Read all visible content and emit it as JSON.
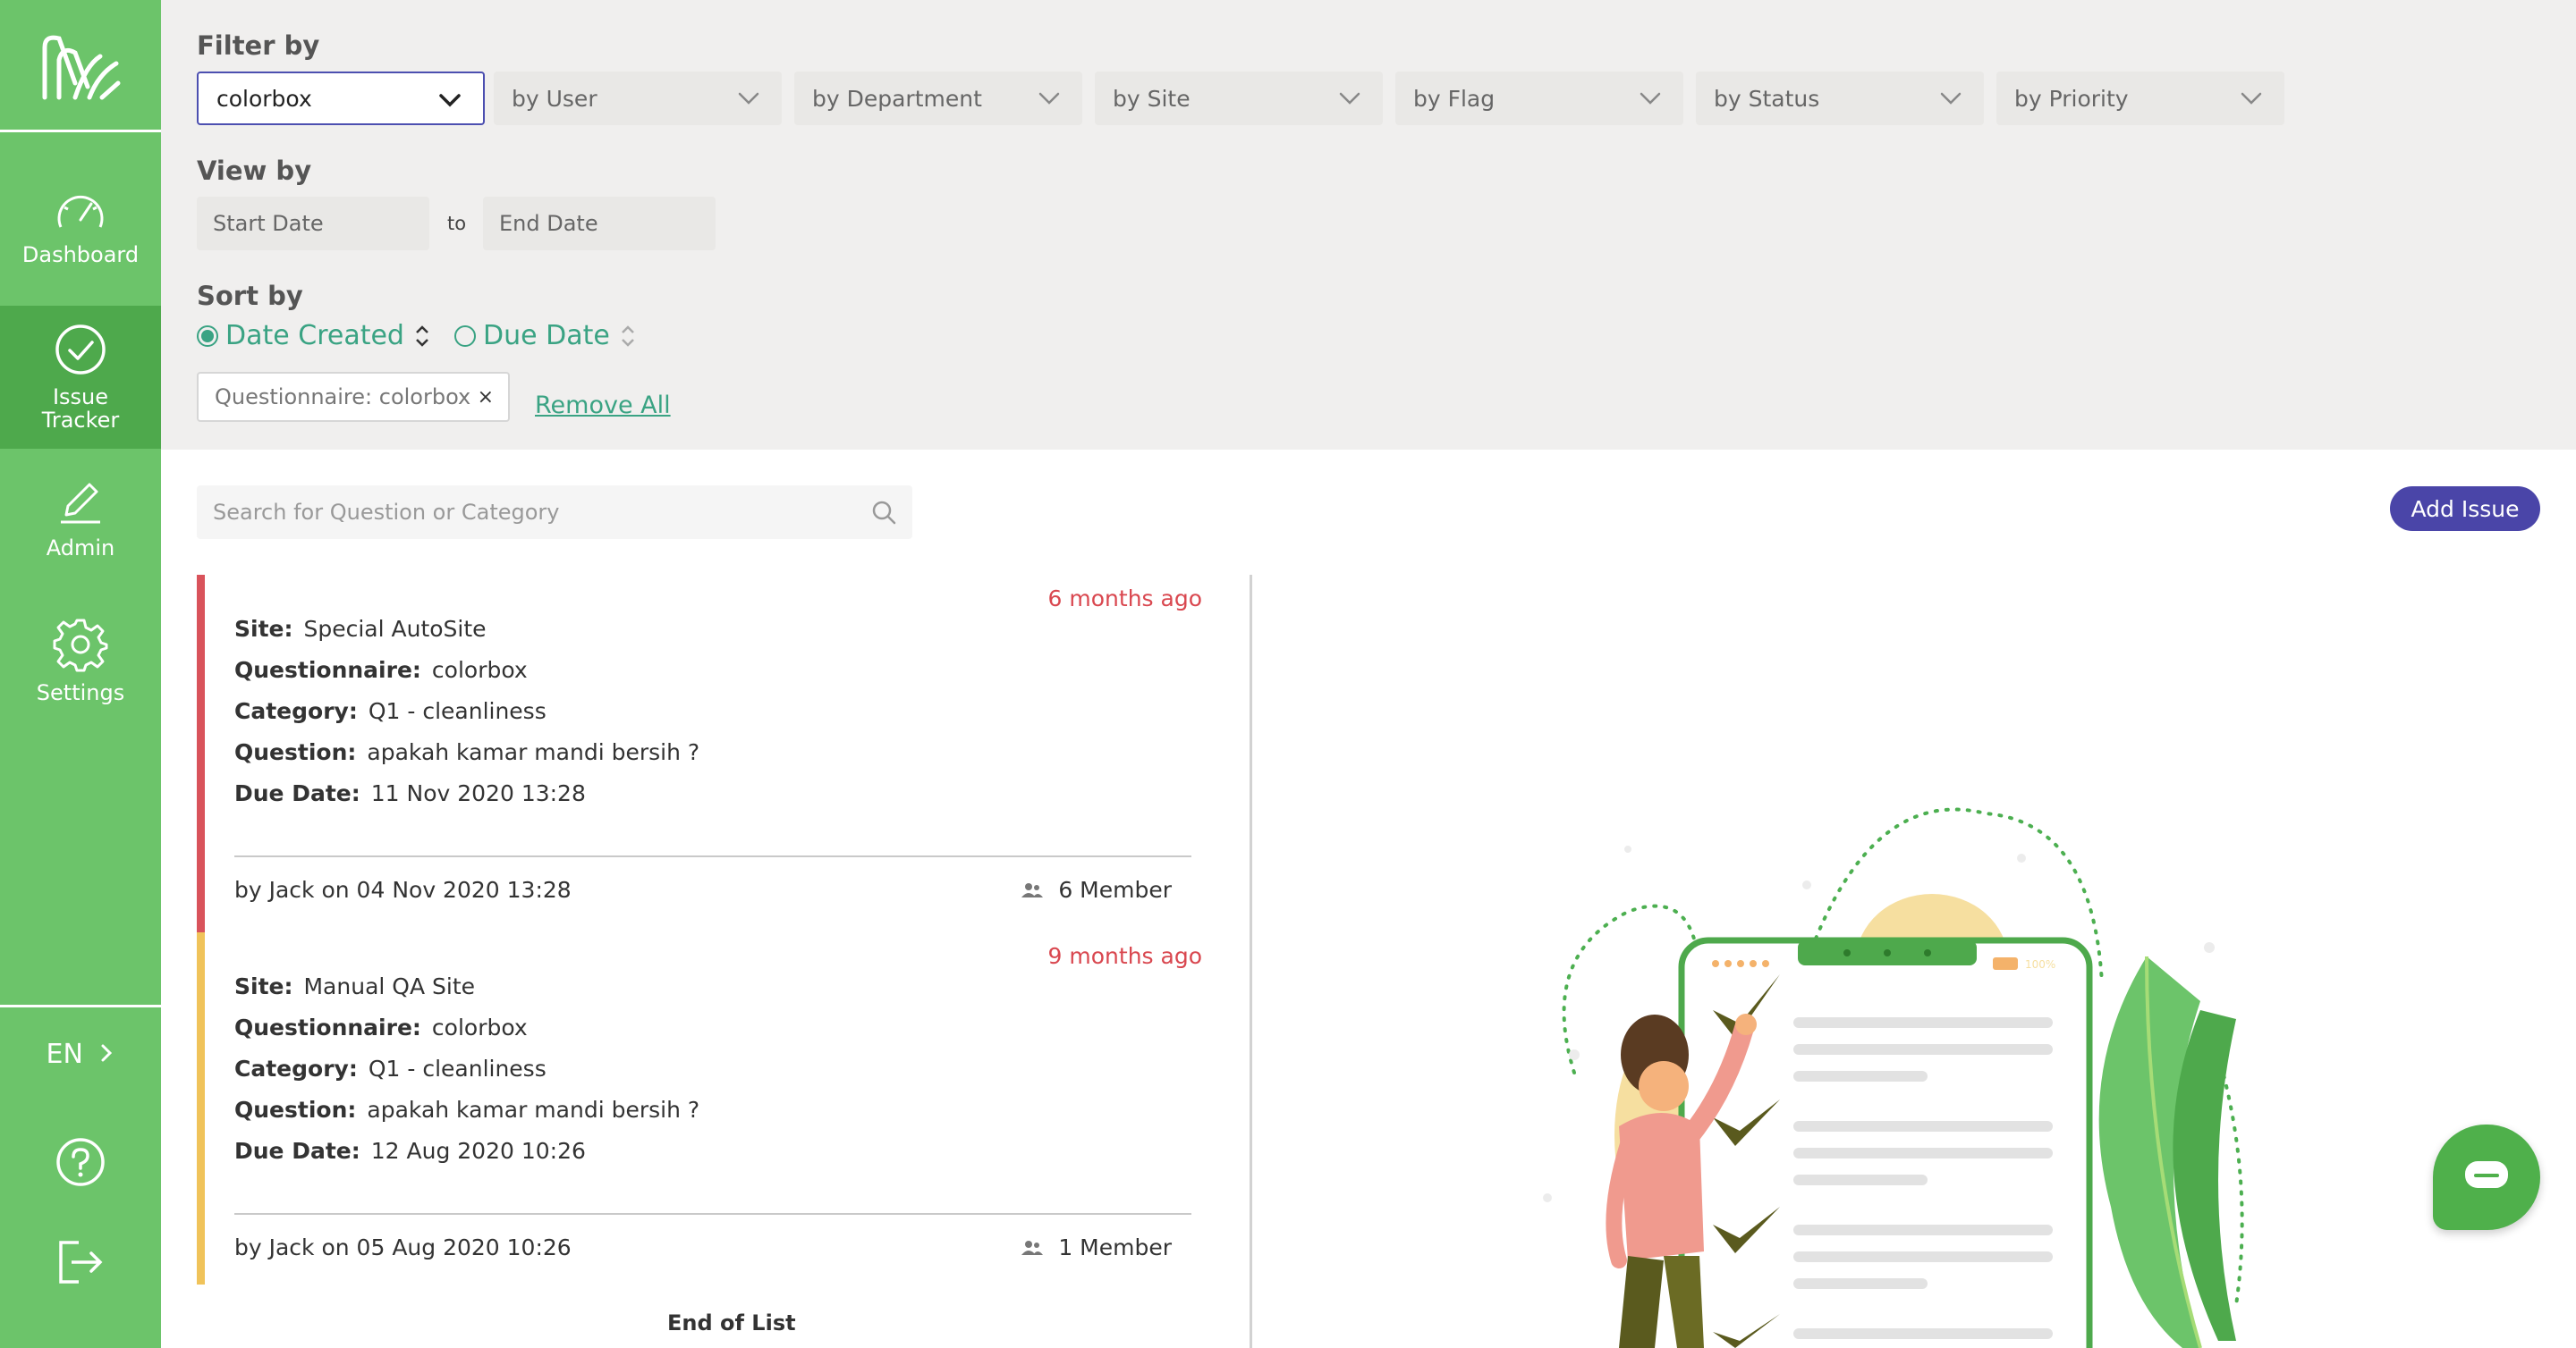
{
  "sidebar": {
    "nav": [
      {
        "label": "Dashboard",
        "icon": "speedometer-icon"
      },
      {
        "label_line1": "Issue",
        "label_line2": "Tracker",
        "icon": "check-circle-icon"
      },
      {
        "label": "Admin",
        "icon": "pencil-icon"
      },
      {
        "label": "Settings",
        "icon": "gear-icon"
      }
    ],
    "language": "EN",
    "accent": "#6cc46a",
    "active_color": "#4ea94c"
  },
  "filter": {
    "title": "Filter by",
    "dropdowns": [
      {
        "value": "colorbox"
      },
      {
        "placeholder": "by User"
      },
      {
        "placeholder": "by Department"
      },
      {
        "placeholder": "by Site"
      },
      {
        "placeholder": "by Flag"
      },
      {
        "placeholder": "by Status"
      },
      {
        "placeholder": "by Priority"
      }
    ]
  },
  "view": {
    "title": "View by",
    "start_placeholder": "Start Date",
    "to": "to",
    "end_placeholder": "End Date"
  },
  "sort": {
    "title": "Sort by",
    "options": [
      {
        "label": "Date Created",
        "selected": true
      },
      {
        "label": "Due Date",
        "selected": false
      }
    ]
  },
  "chips": {
    "active": "Questionnaire: colorbox",
    "remove_symbol": "×",
    "remove_all": "Remove All"
  },
  "search": {
    "placeholder": "Search for Question or Category"
  },
  "add_issue": "Add Issue",
  "issues": [
    {
      "ago": "6 months ago",
      "site_label": "Site:",
      "site": "Special AutoSite",
      "q_label": "Questionnaire:",
      "questionnaire": "colorbox",
      "cat_label": "Category:",
      "category": "Q1 - cleanliness",
      "ques_label": "Question:",
      "question": "apakah kamar mandi bersih ?",
      "due_label": "Due Date:",
      "due": "11 Nov 2020 13:28",
      "by": "by Jack on 04 Nov 2020 13:28",
      "members": "6 Member",
      "bar_color": "#d9535b"
    },
    {
      "ago": "9 months ago",
      "site_label": "Site:",
      "site": "Manual QA Site",
      "q_label": "Questionnaire:",
      "questionnaire": "colorbox",
      "cat_label": "Category:",
      "category": "Q1 - cleanliness",
      "ques_label": "Question:",
      "question": "apakah kamar mandi bersih ?",
      "due_label": "Due Date:",
      "due": "12 Aug 2020 10:26",
      "by": "by Jack on 05 Aug 2020 10:26",
      "members": "1 Member",
      "bar_color": "#f0c35a"
    }
  ],
  "end_of_list": "End of List",
  "illustration_phone_status": "100%"
}
